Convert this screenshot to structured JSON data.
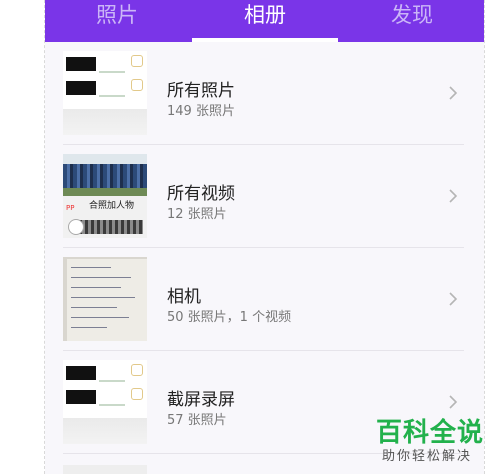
{
  "tabs": [
    {
      "label": "照片",
      "active": false
    },
    {
      "label": "相册",
      "active": true
    },
    {
      "label": "发现",
      "active": false
    }
  ],
  "albums": [
    {
      "name": "所有照片",
      "count": "149 张照片",
      "thumb": "screenshot"
    },
    {
      "name": "所有视频",
      "count": "12 张照片",
      "thumb": "group-photo",
      "thumb_text": "合照加人物"
    },
    {
      "name": "相机",
      "count": "50 张照片，1 个视频",
      "thumb": "paper"
    },
    {
      "name": "截屏录屏",
      "count": "57 张照片",
      "thumb": "screenshot"
    }
  ],
  "watermark": {
    "logo": "百科全说",
    "sub": "助你轻松解决"
  },
  "colors": {
    "accent": "#7a35e8",
    "list_bg": "#f8f7fb",
    "watermark": "#22b14c"
  },
  "icons": {
    "album_chevron": "chevron-right-icon",
    "video_play": "play-icon"
  }
}
